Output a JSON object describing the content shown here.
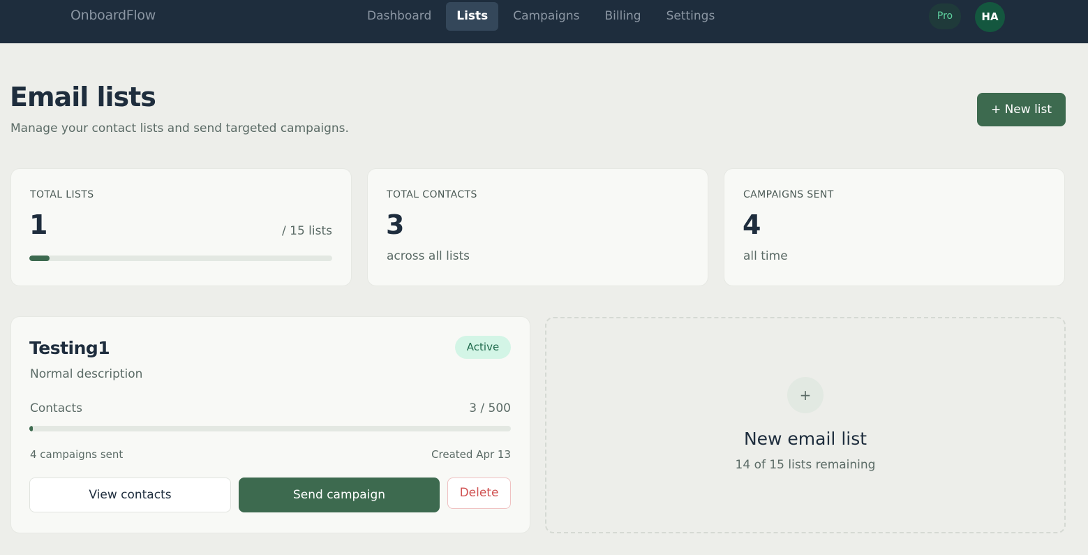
{
  "app": {
    "brand": "OnboardFlow",
    "plan_badge": "Pro",
    "avatar_initials": "HA"
  },
  "nav": {
    "tabs": [
      {
        "label": "Dashboard",
        "active": false
      },
      {
        "label": "Lists",
        "active": true
      },
      {
        "label": "Campaigns",
        "active": false
      },
      {
        "label": "Billing",
        "active": false
      },
      {
        "label": "Settings",
        "active": false
      }
    ]
  },
  "header": {
    "title": "Email lists",
    "subtitle": "Manage your contact lists and send targeted campaigns.",
    "new_list_button": "+ New list"
  },
  "stats": [
    {
      "label": "TOTAL LISTS",
      "value": "1",
      "suffix": "/ 15 lists",
      "progress": 0.0667
    },
    {
      "label": "TOTAL CONTACTS",
      "value": "3",
      "note": "across all lists"
    },
    {
      "label": "CAMPAIGNS SENT",
      "value": "4",
      "note": "all time"
    }
  ],
  "lists": [
    {
      "name": "Testing1",
      "status": "Active",
      "description": "Normal description",
      "contacts_label": "Contacts",
      "contacts_count": "3 / 500",
      "contacts_progress": 0.006,
      "campaigns_sent": "4 campaigns sent",
      "created": "Created Apr 13",
      "buttons": {
        "view": "View contacts",
        "send": "Send campaign",
        "delete": "Delete"
      }
    }
  ],
  "new_list_card": {
    "icon": "plus-icon",
    "glyph": "+",
    "title": "New email list",
    "subtitle": "14 of 15 lists remaining"
  },
  "colors": {
    "nav_bg": "#1e2d3d",
    "accent": "#3d6a4f",
    "page_bg": "#edeeea",
    "danger": "#d05252",
    "active_badge_bg": "#d3f5e6"
  }
}
